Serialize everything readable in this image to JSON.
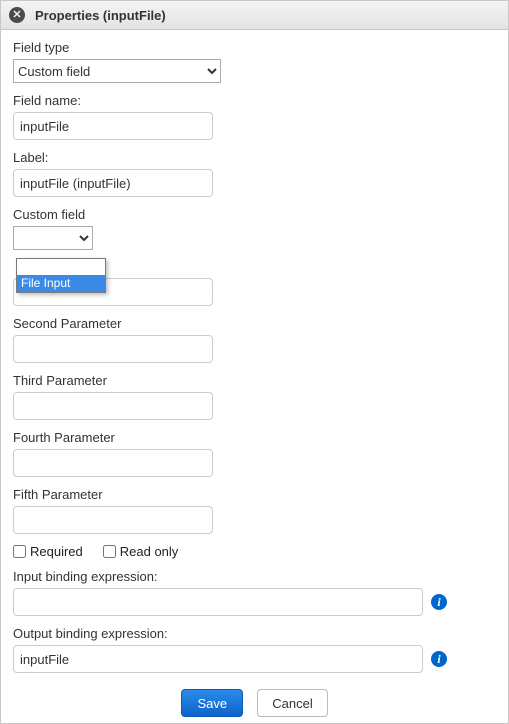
{
  "title": "Properties (inputFile)",
  "fields": {
    "fieldTypeLabel": "Field type",
    "fieldTypeValue": "Custom field",
    "fieldNameLabel": "Field name:",
    "fieldNameValue": "inputFile",
    "labelLabel": "Label:",
    "labelValue": "inputFile (inputFile)",
    "customFieldLabel": "Custom field",
    "customFieldValue": "",
    "customFieldOptions": {
      "blank": "",
      "fileInput": "File Input"
    },
    "secondParamLabel": "Second Parameter",
    "secondParamValue": "",
    "thirdParamLabel": "Third Parameter",
    "thirdParamValue": "",
    "fourthParamLabel": "Fourth Parameter",
    "fourthParamValue": "",
    "fifthParamLabel": "Fifth Parameter",
    "fifthParamValue": "",
    "requiredLabel": "Required",
    "requiredChecked": false,
    "readonlyLabel": "Read only",
    "readonlyChecked": false,
    "inputBindingLabel": "Input binding expression:",
    "inputBindingValue": "",
    "outputBindingLabel": "Output binding expression:",
    "outputBindingValue": "inputFile"
  },
  "buttons": {
    "save": "Save",
    "cancel": "Cancel"
  }
}
